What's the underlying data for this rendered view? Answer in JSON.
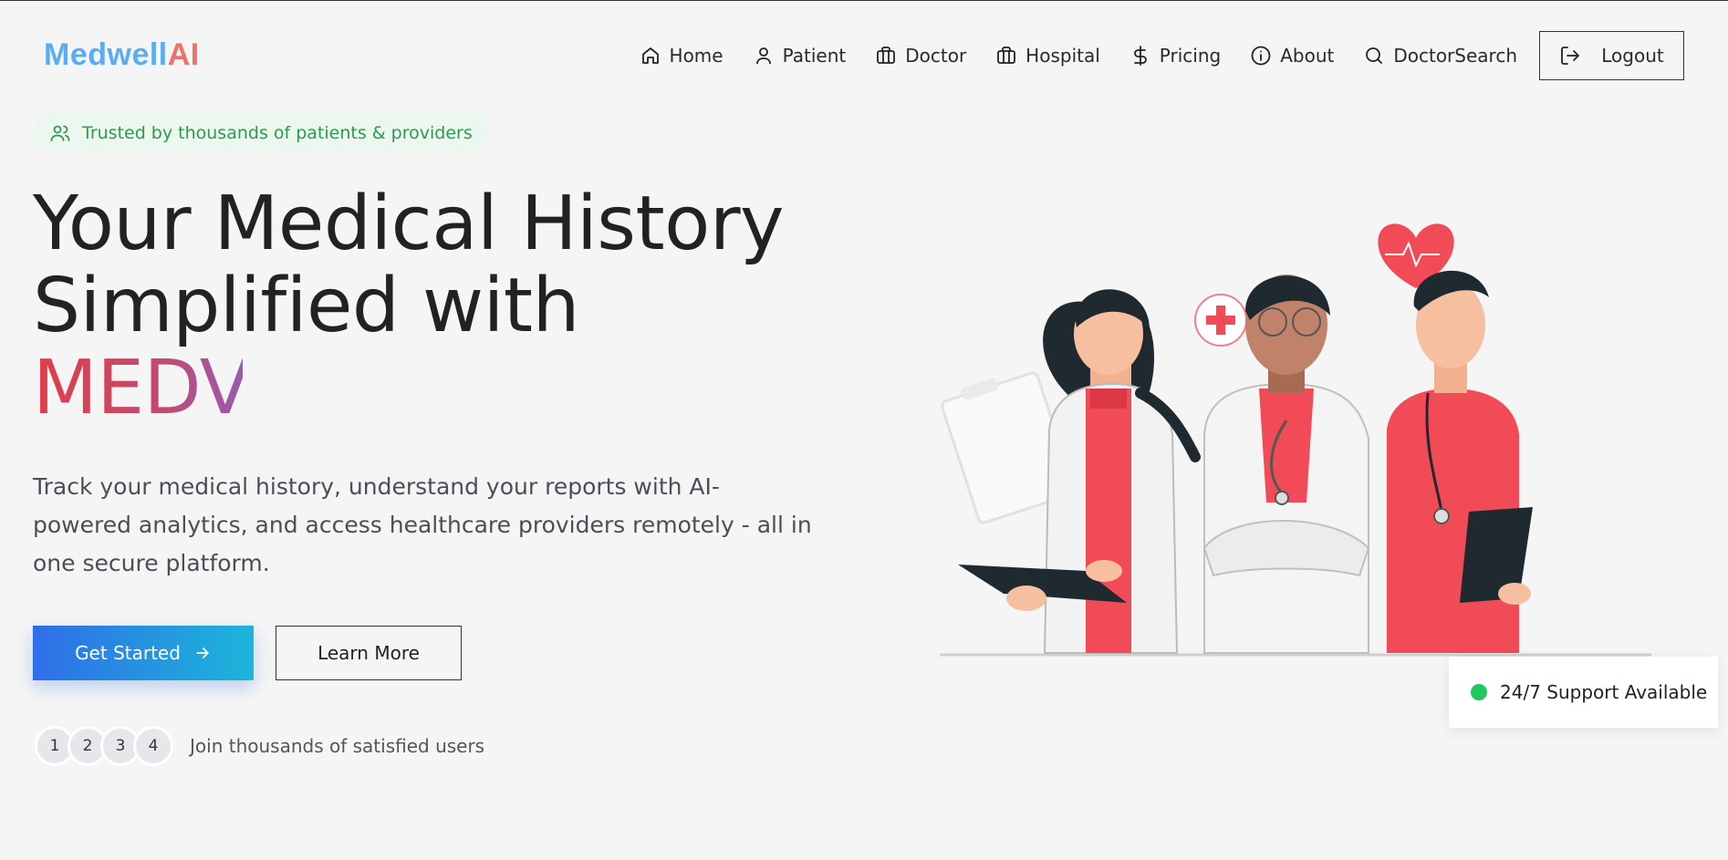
{
  "brand": {
    "part1": "Medwell",
    "part2": "AI"
  },
  "nav": {
    "items": [
      {
        "label": "Home",
        "icon": "home-icon"
      },
      {
        "label": "Patient",
        "icon": "user-icon"
      },
      {
        "label": "Doctor",
        "icon": "briefcase-icon"
      },
      {
        "label": "Hospital",
        "icon": "briefcase-icon"
      },
      {
        "label": "Pricing",
        "icon": "dollar-icon"
      },
      {
        "label": "About",
        "icon": "info-icon"
      },
      {
        "label": "DoctorSearch",
        "icon": "search-icon"
      }
    ],
    "logout": "Logout"
  },
  "badge": {
    "text": "Trusted by thousands of patients & providers",
    "icon": "users-icon"
  },
  "hero": {
    "line1": "Your Medical History",
    "line2": "Simplified with",
    "typed": "MEDV",
    "description": "Track your medical history, understand your reports with AI-powered analytics, and access healthcare providers remotely - all in one secure platform.",
    "primary_button": "Get Started",
    "secondary_button": "Learn More"
  },
  "social_proof": {
    "avatars": [
      "1",
      "2",
      "3",
      "4"
    ],
    "text": "Join thousands of satisfied users"
  },
  "support_card": {
    "text": "24/7 Support Available",
    "status_color": "#22c55e"
  },
  "colors": {
    "brand_blue": "#5aaef0",
    "brand_red": "#f0706a",
    "accent_green": "#2e9a4f",
    "button_gradient_start": "#2f6ee8",
    "button_gradient_end": "#1bb6d9"
  }
}
